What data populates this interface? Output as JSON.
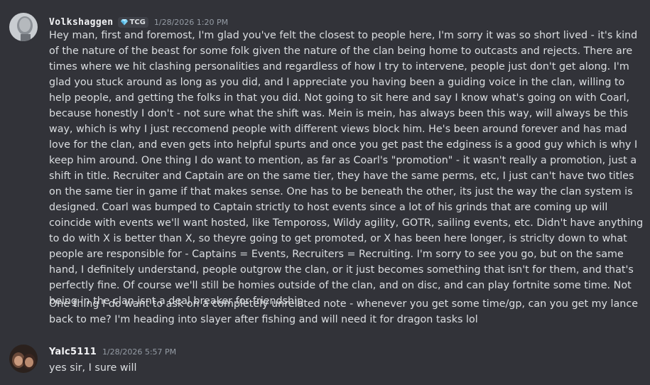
{
  "messages": [
    {
      "username": "Volkshaggen",
      "tag": "TCG",
      "tag_icon": "diamond-icon",
      "timestamp": "1/28/2026 1:20 PM",
      "paragraphs": [
        "Hey man, first and foremost, I'm glad you've felt the closest to people here, I'm sorry it was so short lived - it's kind of the nature of the beast for some folk given the nature of the clan being home to outcasts and rejects. There are times where we hit clashing personalities and regardless of how I try to intervene, people just don't get along. I'm glad you stuck around as long as you did, and I appreciate you having been a guiding voice in the clan, willing to help people, and getting the folks in that you did. Not going to sit here and say I know what's going on with Coarl, because honestly I don't - not sure what the shift was. Mein is mein, has always been this way, will always be this way, which is why I just reccomend people with different views block him. He's been around forever and has mad love for the clan, and even gets into helpful spurts and once you get past the edginess is a good guy which is why I keep him around. One thing I do want to mention, as far as Coarl's \"promotion\" - it wasn't really a promotion, just a shift in title. Recruiter and Captain are on the same tier, they have the same perms, etc, I just can't have two titles on the same tier in game if that makes sense. One has to be beneath the other, its just the way the clan system is designed. Coarl was bumped to Captain strictly to host events since a lot of his grinds that are coming up will coincide with events we'll want hosted, like Tempoross, Wildy agility, GOTR, sailing events, etc. Didn't have anything to do with X is better than X, so theyre going to get promoted, or X has been here longer, is striclty down to what people are responsible for - Captains = Events, Recruiters = Recruiting. I'm sorry to see you go, but on the same hand, I definitely understand, people outgrow the clan, or it just becomes something that isn't for them, and that's perfectly fine. Of course we'll still be homies outside of the clan, and on disc, and can play fortnite some time. Not being in the clan isnt a deal breaker for friendship",
        "One thing I do want to ask on a completely unrelated note - whenever you get some time/gp, can you get my lance back to me? I'm heading into slayer after fishing and will need it for dragon tasks lol"
      ]
    },
    {
      "username": "Yalc5111",
      "timestamp": "1/28/2026 5:57 PM",
      "paragraphs": [
        "yes sir, I sure will"
      ]
    }
  ],
  "colors": {
    "background": "#323339",
    "text": "#dbdee1",
    "username": "#f2f3f5",
    "timestamp": "#949ba4",
    "tag_background": "#3f4148"
  }
}
